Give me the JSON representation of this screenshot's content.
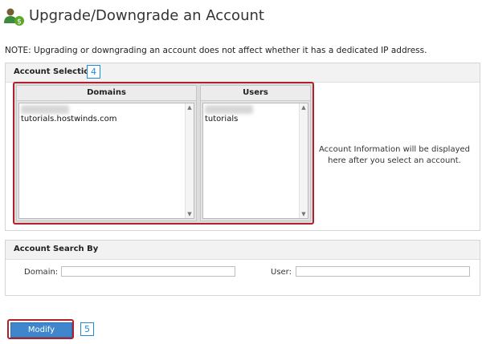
{
  "header": {
    "title": "Upgrade/Downgrade an Account",
    "icon": "user-upgrade-icon"
  },
  "note": "NOTE: Upgrading or downgrading an account does not affect whether it has a dedicated IP address.",
  "account_selection": {
    "heading": "Account Selection",
    "step_badge": "4",
    "domains": {
      "header": "Domains",
      "items": [
        "tutorials.hostwinds.com"
      ]
    },
    "users": {
      "header": "Users",
      "items": [
        "tutorials"
      ]
    },
    "info_text": "Account Information will be displayed here after you select an account."
  },
  "account_search": {
    "heading": "Account Search By",
    "domain_label": "Domain:",
    "domain_value": "",
    "user_label": "User:",
    "user_value": ""
  },
  "actions": {
    "modify_label": "Modify",
    "step_badge": "5"
  },
  "colors": {
    "highlight": "#b0212b",
    "badge": "#1f8dd6",
    "button": "#3f86cc"
  }
}
